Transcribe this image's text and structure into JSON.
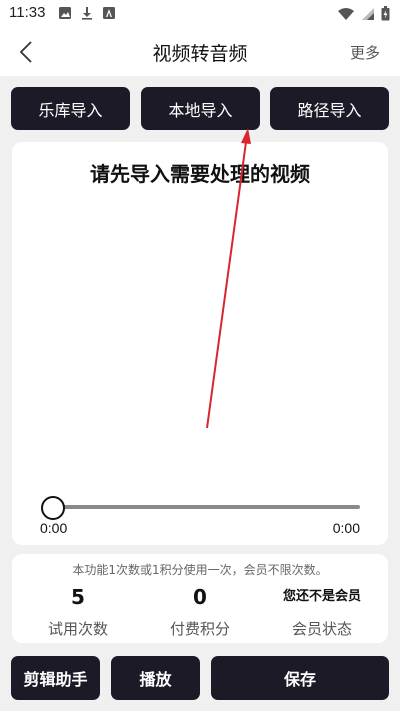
{
  "status_bar": {
    "time": "11:33",
    "left_icons": [
      "image-icon",
      "download-icon",
      "font-icon"
    ],
    "right_icons": [
      "wifi-icon",
      "signal-icon",
      "battery-icon"
    ]
  },
  "header": {
    "title": "视频转音频",
    "more_label": "更多"
  },
  "import_buttons": {
    "library_label": "乐库导入",
    "local_label": "本地导入",
    "path_label": "路径导入"
  },
  "video_panel": {
    "prompt": "请先导入需要处理的视频",
    "current_time": "0:00",
    "total_time": "0:00",
    "progress": 0
  },
  "info_panel": {
    "note": "本功能1次数或1积分使用一次，会员不限次数。",
    "stats": [
      {
        "value": "5",
        "label": "试用次数"
      },
      {
        "value": "0",
        "label": "付费积分"
      },
      {
        "value": "您还不是会员",
        "label": "会员状态"
      }
    ]
  },
  "bottom_buttons": {
    "edit_label": "剪辑助手",
    "play_label": "播放",
    "save_label": "保存"
  },
  "colors": {
    "button_bg": "#1b1a26",
    "annotation_arrow": "#d9262e",
    "page_bg": "#f0f0f0"
  }
}
